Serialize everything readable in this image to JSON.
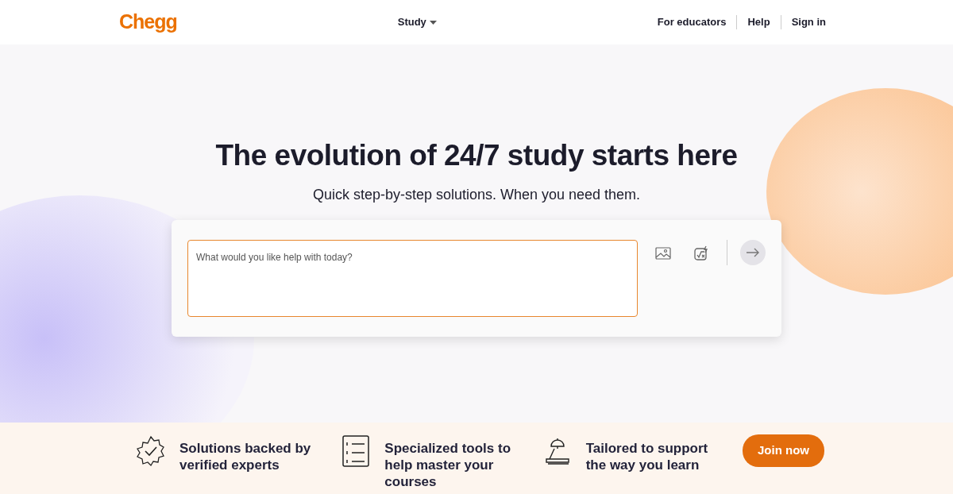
{
  "header": {
    "logo": "Chegg",
    "nav": [
      {
        "label": "Study",
        "dropdown": true
      }
    ],
    "links": [
      "For educators",
      "Help",
      "Sign in"
    ]
  },
  "hero": {
    "title": "The evolution of 24/7 study starts here",
    "subtitle": "Quick step-by-step solutions. When you need them.",
    "search": {
      "placeholder": "What would you like help with today?"
    }
  },
  "features": [
    {
      "kind": "badge",
      "text": "Solutions backed by verified experts"
    },
    {
      "kind": "list",
      "text": "Specialized tools to help master your courses"
    },
    {
      "kind": "lamp",
      "text": "Tailored to support the way you learn"
    }
  ],
  "cta": "Join now"
}
